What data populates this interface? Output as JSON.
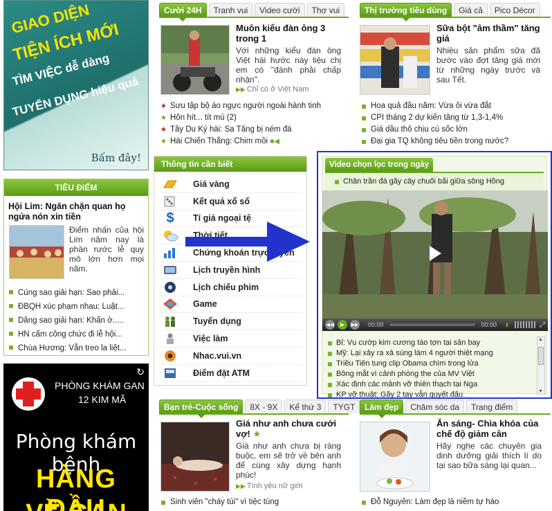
{
  "ad_top": {
    "lines": [
      "GIAO DIỆN",
      "TIỆN ÍCH MỚI",
      "TÌM VIỆC dễ dàng",
      "TUYỂN DỤNG hiệu quả"
    ],
    "cta": "Bấm đây!"
  },
  "funny": {
    "tabs": [
      "Cười 24H",
      "Tranh vui",
      "Video cười",
      "Thơ vui"
    ],
    "headline": "Muôn kiểu đàn ông 3 trong 1",
    "summary": "Với những kiểu đàn ông Việt hài hước này liệu chị em có \"đành phải chấp nhận\".",
    "more": "Chỉ có ở Việt Nam",
    "items": [
      "Sưu tập bộ áo ngực người ngoài hành tinh",
      "Hôn hít... tít mù (2)",
      "Tây Du Ký hài: Sa Tăng bị ném đá",
      "Hài Chiến Thắng: Chim mồi"
    ]
  },
  "market": {
    "tabs": [
      "Thị trường tiêu dùng",
      "Giá cả",
      "Pico Décor"
    ],
    "headline": "Sữa bột \"âm thầm\" tăng giá",
    "summary": "Nhiều sản phẩm sữa đã bước vào đợt tăng giá mới từ những ngày trước và sau Tết.",
    "items": [
      "Hoa quả đầu năm: Vừa ôi vừa đắt",
      "CPI tháng 2 dự kiến tăng từ 1,3-1,4%",
      "Giá dầu thô chịu cú sốc lớn",
      "Đại gia TQ không tiêu tiền trong nước?"
    ]
  },
  "focus": {
    "title": "TIÊU ĐIỂM",
    "headline": "Hội Lim: Ngăn chặn quan họ ngửa nón xin tiền",
    "summary": "Điểm nhấn của hội Lim năm nay là phần rước lễ quy mô lớn hơn mọi năm.",
    "items": [
      "Cúng sao giải hạn: Sao phải...",
      "ĐBQH xúc phạm nhau: Luật...",
      "Dâng sao giải hạn: Khấn ở.....",
      "HN cấm công chức đi lễ hội...",
      "Chùa Hương: Vẫn treo la liệt..."
    ]
  },
  "ad_bottom": {
    "clinic": "PHÒNG KHÁM GAN",
    "address": "12 KIM MÃ",
    "tagline": "Phòng khám bệnh",
    "big": "HÀNG ĐẦU",
    "big2": "VỀ GAN"
  },
  "info": {
    "title": "Thông tin cần biết",
    "items": [
      {
        "label": "Giá vàng",
        "icon": "gold-icon"
      },
      {
        "label": "Kết quả xổ số",
        "icon": "dice-icon"
      },
      {
        "label": "Tỉ giá ngoại tệ",
        "icon": "dollar-icon"
      },
      {
        "label": "Thời tiết",
        "icon": "weather-icon"
      },
      {
        "label": "Chứng khoán trực tuyến",
        "icon": "stock-chart-icon"
      },
      {
        "label": "Lịch truyền hình",
        "icon": "tv-icon"
      },
      {
        "label": "Lịch chiếu phim",
        "icon": "film-icon"
      },
      {
        "label": "Game",
        "icon": "game-icon"
      },
      {
        "label": "Tuyển dụng",
        "icon": "recruit-icon"
      },
      {
        "label": "Việc làm",
        "icon": "job-icon"
      },
      {
        "label": "Nhac.vui.vn",
        "icon": "music-icon"
      },
      {
        "label": "Điểm đặt ATM",
        "icon": "atm-icon"
      }
    ]
  },
  "video": {
    "tab": "Video chọn lọc trong ngày",
    "current": "Chân trần đá gãy cây chuối bãi giữa sông Hồng",
    "time_elapsed": "00:00",
    "time_total": "00:00",
    "items": [
      "Bỉ: Vụ cướp kim cương táo tợn tại sân bay",
      "Mỹ: Lại xảy ra xả súng làm 4 người thiệt mạng",
      "Triều Tiên tung clip Obama chìm trong lửa",
      "Bông mắt vì cảnh phòng the của MV Việt",
      "Xác định các mảnh vỡ thiên thạch tại Nga",
      "KP vỡ thuật: Gãy 2 tay vẫn quyết đấu"
    ]
  },
  "youth": {
    "tabs": [
      "Bạn trẻ-Cuộc sống",
      "8X - 9X",
      "Kể thứ 3",
      "TYGT"
    ],
    "headline": "Giá như anh chưa cưới vợ!",
    "summary": "Giá như anh chưa bị ràng buộc, em sẽ trở về bên anh để cùng xây dựng hạnh phúc!",
    "more": "Tình yêu nữ giới",
    "items": [
      "Sinh viên \"cháy túi\" vì tiệc tùng"
    ]
  },
  "beauty": {
    "tabs": [
      "Làm đẹp",
      "Chăm sóc da",
      "Trang điểm"
    ],
    "headline": "Ăn sáng- Chìa khóa của chế độ giảm cân",
    "summary": "Hãy nghe các chuyên gia dinh dưỡng giải thích lí do tại sao bữa sáng lại quan...",
    "items": [
      "Đỗ Nguyên: Làm đẹp là niềm tự hào"
    ]
  }
}
